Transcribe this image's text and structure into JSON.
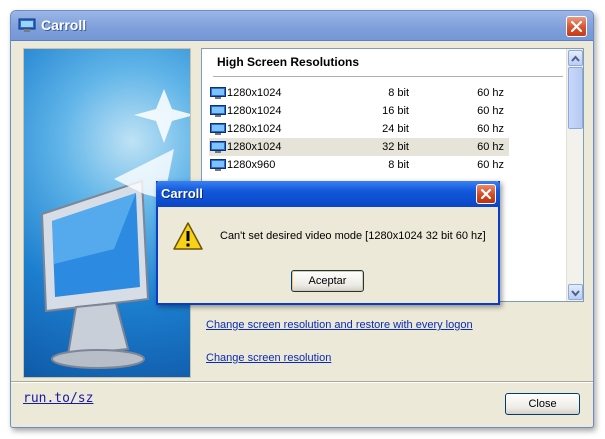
{
  "window": {
    "title": "Carroll"
  },
  "resolutions": {
    "header": "High Screen Resolutions",
    "rows": [
      {
        "res": "1280x1024",
        "bit": "8 bit",
        "hz": "60 hz"
      },
      {
        "res": "1280x1024",
        "bit": "16 bit",
        "hz": "60 hz"
      },
      {
        "res": "1280x1024",
        "bit": "24 bit",
        "hz": "60 hz"
      },
      {
        "res": "1280x1024",
        "bit": "32 bit",
        "hz": "60 hz",
        "selected": true
      },
      {
        "res": "1280x960",
        "bit": "8 bit",
        "hz": "60 hz"
      }
    ]
  },
  "links": {
    "restore": "Change screen resolution and restore with every logon",
    "change": "Change screen resolution"
  },
  "footer": {
    "link": "run.to/sz",
    "close_label": "Close"
  },
  "dialog": {
    "title": "Carroll",
    "message": "Can't set desired video mode [1280x1024 32 bit 60 hz]",
    "accept_label": "Aceptar"
  },
  "icons": {
    "app": "monitor-icon",
    "warning": "warning-icon",
    "close": "close-icon"
  },
  "colors": {
    "titlebar": "#7e9fda",
    "dialog_titlebar": "#1157d9",
    "close": "#d8522f",
    "link": "#0a2bb2"
  }
}
